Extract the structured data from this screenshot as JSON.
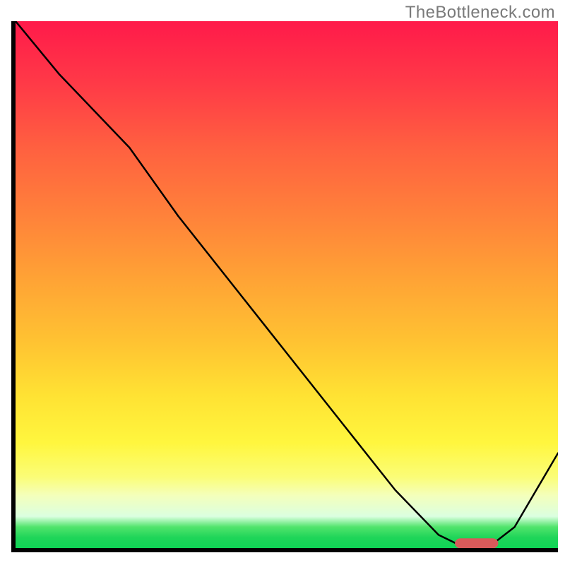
{
  "watermark": "TheBottleneck.com",
  "chart_data": {
    "type": "line",
    "title": "",
    "xlabel": "",
    "ylabel": "",
    "xlim": [
      0,
      100
    ],
    "ylim": [
      0,
      100
    ],
    "x": [
      0,
      8,
      21,
      30,
      40,
      50,
      60,
      70,
      78,
      83,
      87,
      92,
      100
    ],
    "values": [
      100,
      90,
      76,
      63,
      50,
      37,
      24,
      11,
      2.5,
      0,
      0,
      4,
      18
    ],
    "note": "Background is a continuous vertical gradient from red (bottleneck) at top to green (optimal) at bottom. Black curve descends from top-left, kinks near x≈21, continues near-linear then bottoms out around x≈83–87 (green band) and rises toward the right edge. Short horizontal pink marker sits at the curve minimum.",
    "marker": {
      "x_start": 81,
      "x_end": 89,
      "y": 0.9,
      "color": "#d95a5a"
    },
    "gradient_stops": [
      {
        "pos": 0.0,
        "color": "#ff1a4a"
      },
      {
        "pos": 0.12,
        "color": "#ff3a47"
      },
      {
        "pos": 0.24,
        "color": "#ff6040"
      },
      {
        "pos": 0.37,
        "color": "#ff823a"
      },
      {
        "pos": 0.49,
        "color": "#ffa335"
      },
      {
        "pos": 0.61,
        "color": "#ffc332"
      },
      {
        "pos": 0.71,
        "color": "#ffe233"
      },
      {
        "pos": 0.8,
        "color": "#fff63e"
      },
      {
        "pos": 0.865,
        "color": "#fbfd77"
      },
      {
        "pos": 0.9,
        "color": "#f4ffbb"
      },
      {
        "pos": 0.94,
        "color": "#dbffe0"
      },
      {
        "pos": 0.96,
        "color": "#51e46c"
      },
      {
        "pos": 0.98,
        "color": "#1fd559"
      },
      {
        "pos": 1.0,
        "color": "#0fd556"
      }
    ]
  }
}
